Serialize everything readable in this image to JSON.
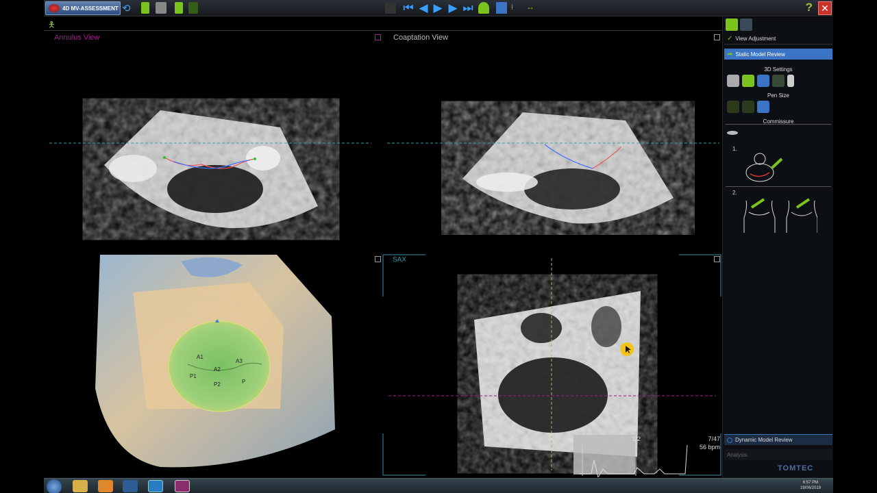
{
  "app": {
    "mode_label": "4D MV-ASSESSMENT",
    "help": "?",
    "close": "✕"
  },
  "viewports": {
    "annulus": {
      "title": "Annulus View"
    },
    "coaptation": {
      "title": "Coaptation View"
    },
    "render3d": {
      "leaflet_labels": [
        "A1",
        "A2",
        "A3",
        "P1",
        "P2",
        "P"
      ]
    },
    "sax": {
      "title": "SAX",
      "frame_label": "1/2",
      "frame_counter": "7/47",
      "heart_rate": "56 bpm"
    }
  },
  "panel": {
    "view_adjustment": "View Adjustment",
    "static_model_review": "Static Model Review",
    "settings_3d": "3D Settings",
    "pen_size": "Pen Size",
    "commissure": "Commissure",
    "step1": "1.",
    "step2": "2.",
    "dynamic_model_review": "Dynamic Model Review",
    "analysis": "Analysis",
    "brand": "TOMTEC"
  },
  "taskbar": {
    "time": "6:57 PM",
    "date": "19/06/2019"
  },
  "colors": {
    "accent_green": "#7cc31f",
    "accent_blue": "#3b74c4",
    "annulus_label": "#a01e8d",
    "sax_label": "#3d8fa6",
    "close_red": "#c7322b"
  },
  "icons": [
    "walk-icon",
    "play-icon",
    "step-back-icon",
    "step-forward-icon",
    "help-icon",
    "close-icon",
    "checkmark-icon",
    "arrow-right-icon",
    "cursor-icon"
  ]
}
